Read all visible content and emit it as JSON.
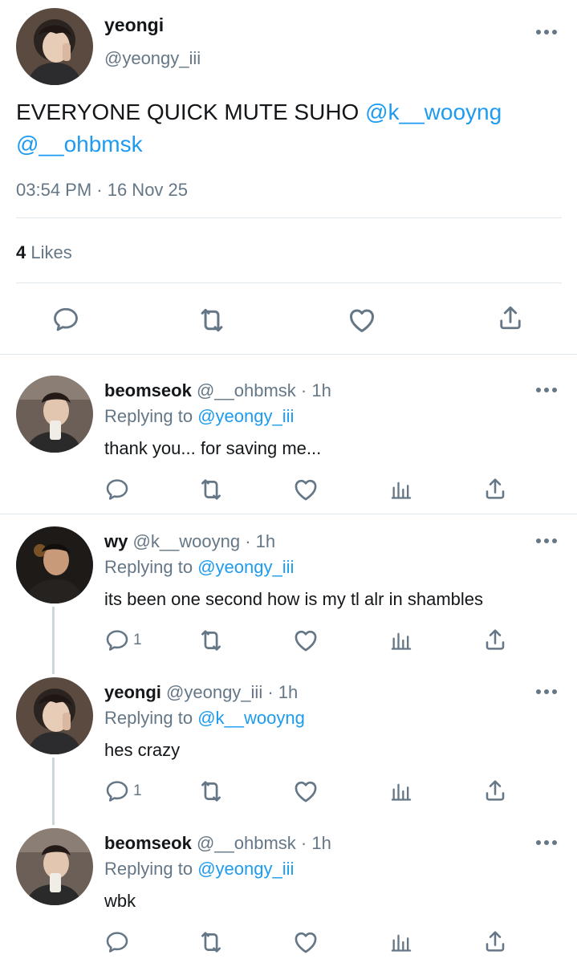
{
  "main_tweet": {
    "name": "yeongi",
    "handle": "@yeongy_iii",
    "text": "EVERYONE QUICK MUTE SUHO ",
    "mention1": "@k__wooyng",
    "mention2": "@__ohbmsk",
    "timestamp": "03:54 PM · 16 Nov 25",
    "likes_count": "4",
    "likes_label": "Likes",
    "actions": [
      "reply-icon",
      "retweet-icon",
      "like-icon",
      "share-icon"
    ]
  },
  "replies": [
    {
      "name": "beomseok",
      "handle_time": "@__ohbmsk · 1h",
      "replying_prefix": "Replying to ",
      "replying_to": "@yeongy_iii",
      "text": "thank you... for saving me...",
      "reply_count": ""
    },
    {
      "name": "wy",
      "handle_time": "@k__wooyng · 1h",
      "replying_prefix": "Replying to ",
      "replying_to": "@yeongy_iii",
      "text": "its been one second how is my tl alr in shambles",
      "reply_count": "1"
    },
    {
      "name": "yeongi",
      "handle_time": "@yeongy_iii · 1h",
      "replying_prefix": "Replying to ",
      "replying_to": "@k__wooyng",
      "text": "hes crazy",
      "reply_count": "1"
    },
    {
      "name": "beomseok",
      "handle_time": "@__ohbmsk · 1h",
      "replying_prefix": "Replying to ",
      "replying_to": "@yeongy_iii",
      "text": "wbk",
      "reply_count": ""
    }
  ],
  "colors": {
    "accent": "#1d9bf0",
    "secondary": "#657786",
    "divider": "#e1e8ed"
  }
}
